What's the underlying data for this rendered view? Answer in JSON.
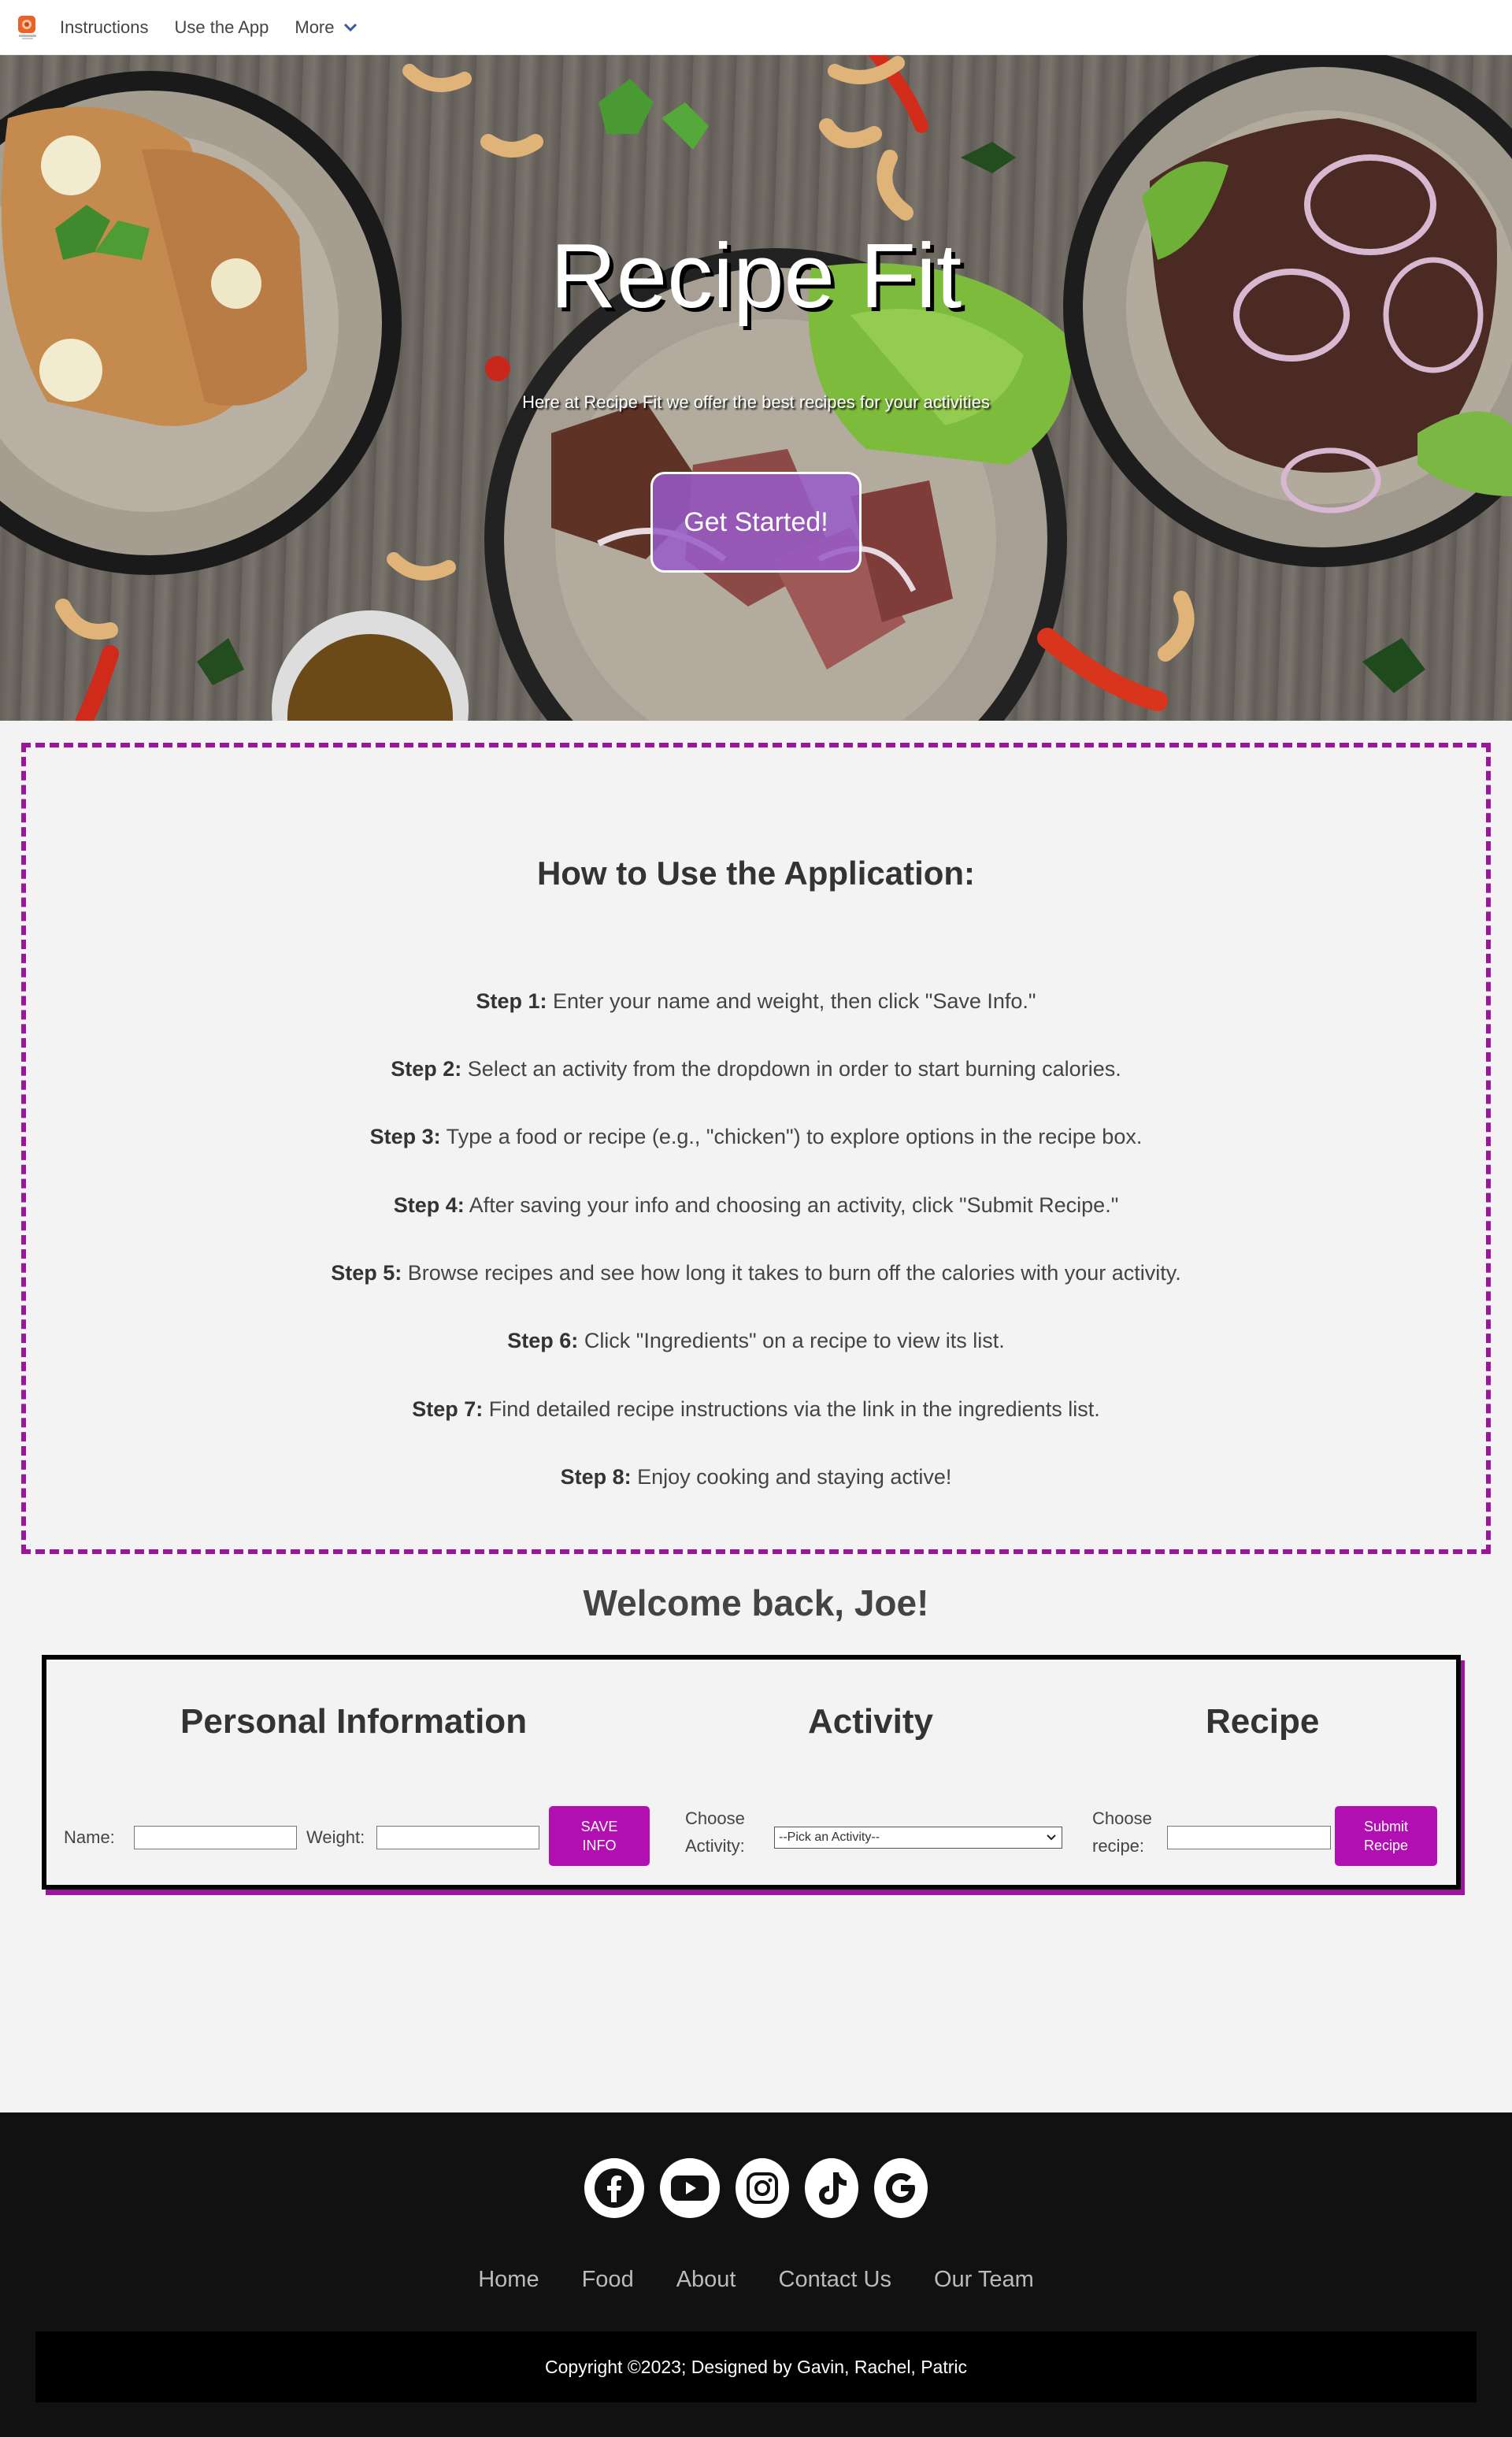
{
  "nav": {
    "items": [
      "Instructions",
      "Use the App",
      "More"
    ]
  },
  "hero": {
    "title": "Recipe Fit",
    "subtitle": "Here at Recipe Fit we offer the best recipes for your activities",
    "button": "Get Started!"
  },
  "instructions": {
    "heading": "How to Use the Application:",
    "steps": [
      {
        "label": "Step 1:",
        "text": " Enter your name and weight, then click \"Save Info.\""
      },
      {
        "label": "Step 2:",
        "text": " Select an activity from the dropdown in order to start burning calories."
      },
      {
        "label": "Step 3:",
        "text": " Type a food or recipe (e.g., \"chicken\") to explore options in the recipe box."
      },
      {
        "label": "Step 4:",
        "text": " After saving your info and choosing an activity, click \"Submit Recipe.\""
      },
      {
        "label": "Step 5:",
        "text": " Browse recipes and see how long it takes to burn off the calories with your activity."
      },
      {
        "label": "Step 6:",
        "text": " Click \"Ingredients\" on a recipe to view its list."
      },
      {
        "label": "Step 7:",
        "text": " Find detailed recipe instructions via the link in the ingredients list."
      },
      {
        "label": "Step 8:",
        "text": " Enjoy cooking and staying active!"
      }
    ]
  },
  "welcome": "Welcome back, Joe!",
  "form": {
    "personal_heading": "Personal Information",
    "activity_heading": "Activity",
    "recipe_heading": "Recipe",
    "name_label": "Name:",
    "weight_label": "Weight:",
    "save_button_line1": "SAVE",
    "save_button_line2": "INFO",
    "activity_label_line1": "Choose",
    "activity_label_line2": "Activity:",
    "activity_selected": "--Pick an Activity--",
    "recipe_label_line1": "Choose",
    "recipe_label_line2": "recipe:",
    "submit_button_line1": "Submit",
    "submit_button_line2": "Recipe"
  },
  "footer": {
    "socials": [
      "facebook-icon",
      "youtube-icon",
      "instagram-icon",
      "tiktok-icon",
      "google-icon"
    ],
    "links": [
      "Home",
      "Food",
      "About",
      "Contact Us",
      "Our Team"
    ],
    "copyright": "Copyright ©2023; Designed by Gavin, Rachel, Patric"
  },
  "colors": {
    "accent": "#9b169b",
    "button": "#b10fb1",
    "footer_bg": "#111111",
    "hero_button": "#965ac8"
  }
}
